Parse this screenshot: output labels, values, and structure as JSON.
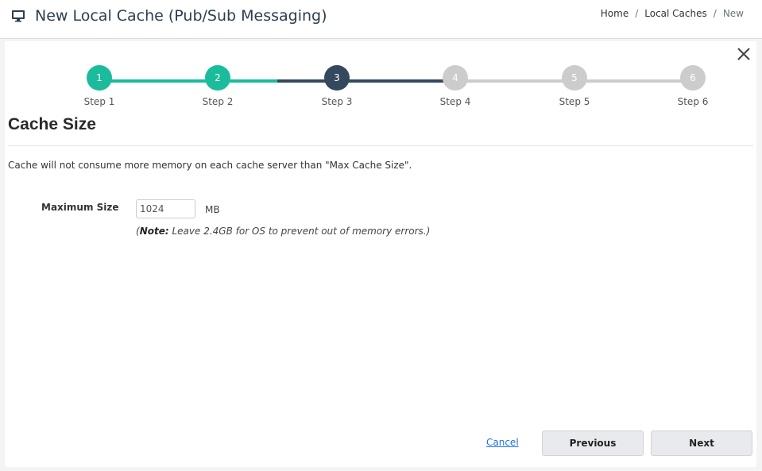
{
  "header": {
    "title": "New Local Cache (Pub/Sub Messaging)",
    "icon": "monitor-icon",
    "breadcrumb": [
      {
        "label": "Home"
      },
      {
        "label": "Local Caches"
      },
      {
        "label": "New"
      }
    ],
    "breadcrumb_separator": "/"
  },
  "wizard": {
    "steps": [
      {
        "number": "1",
        "label": "Step 1",
        "state": "completed"
      },
      {
        "number": "2",
        "label": "Step 2",
        "state": "completed"
      },
      {
        "number": "3",
        "label": "Step 3",
        "state": "active"
      },
      {
        "number": "4",
        "label": "Step 4",
        "state": "pending"
      },
      {
        "number": "5",
        "label": "Step 5",
        "state": "pending"
      },
      {
        "number": "6",
        "label": "Step 6",
        "state": "pending"
      }
    ],
    "colors": {
      "completed": "#1abc9c",
      "active": "#34495e",
      "pending": "#cccccc"
    },
    "close_icon": "close-icon"
  },
  "section": {
    "title": "Cache Size",
    "description": "Cache will not consume more memory on each cache server than \"Max Cache Size\".",
    "field_label": "Maximum Size",
    "field_value": "1024",
    "unit": "MB",
    "note_prefix": "(",
    "note_bold": "Note:",
    "note_text": " Leave 2.4GB for OS to prevent out of memory errors.)"
  },
  "footer": {
    "cancel_label": "Cancel",
    "previous_label": "Previous",
    "next_label": "Next"
  }
}
